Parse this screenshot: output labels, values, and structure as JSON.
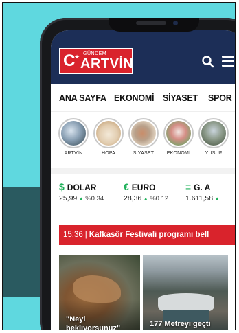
{
  "header": {
    "logo_c": "C",
    "logo_star": "★",
    "logo_gundem": "GÜNDEM",
    "logo_artvin": "ARTVİN"
  },
  "nav": {
    "categories": [
      "ANA SAYFA",
      "EKONOMİ",
      "SİYASET",
      "SPOR"
    ]
  },
  "stories": [
    {
      "label": "ARTVİN"
    },
    {
      "label": "HOPA"
    },
    {
      "label": "SİYASET"
    },
    {
      "label": "EKONOMİ"
    },
    {
      "label": "YUSUF"
    }
  ],
  "currencies": [
    {
      "icon": "$",
      "name": "DOLAR",
      "value": "25,99",
      "change": "%0.34"
    },
    {
      "icon": "€",
      "name": "EURO",
      "value": "28,36",
      "change": "%0.12"
    },
    {
      "icon": "≡",
      "name": "G. A",
      "value": "1.611,58",
      "change": ""
    }
  ],
  "breaking": {
    "time": "15:36",
    "divider": "|",
    "text": "Kafkasör Festivali programı bell"
  },
  "cards": [
    {
      "caption": "\"Neyi bekliyorsunuz\""
    },
    {
      "caption": "177 Metreyi geçti"
    }
  ],
  "colors": {
    "background": "#5fd8df",
    "topbar": "#1c2e57",
    "brand_red": "#d9232c",
    "up_green": "#1fb15a"
  }
}
